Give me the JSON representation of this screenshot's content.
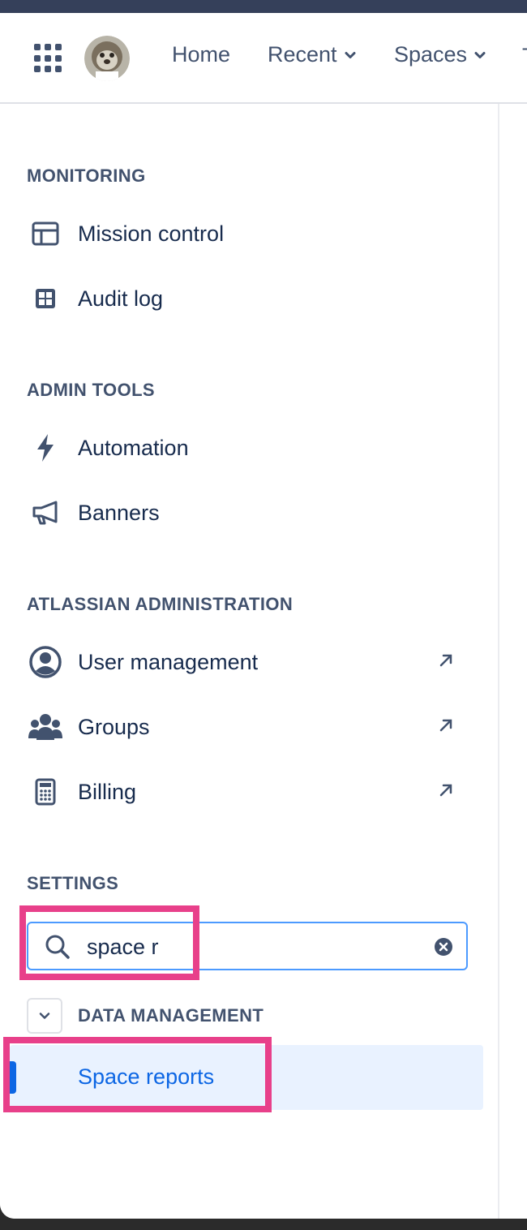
{
  "header": {
    "nav": [
      {
        "label": "Home",
        "has_chevron": false
      },
      {
        "label": "Recent",
        "has_chevron": true
      },
      {
        "label": "Spaces",
        "has_chevron": true
      }
    ],
    "overflow_char": "T"
  },
  "sidebar": {
    "sections": [
      {
        "title": "MONITORING",
        "items": [
          {
            "label": "Mission control",
            "icon": "layout-icon",
            "external": false
          },
          {
            "label": "Audit log",
            "icon": "grid-icon",
            "external": false
          }
        ]
      },
      {
        "title": "ADMIN TOOLS",
        "items": [
          {
            "label": "Automation",
            "icon": "lightning-icon",
            "external": false
          },
          {
            "label": "Banners",
            "icon": "megaphone-icon",
            "external": false
          }
        ]
      },
      {
        "title": "ATLASSIAN ADMINISTRATION",
        "items": [
          {
            "label": "User management",
            "icon": "user-circle-icon",
            "external": true
          },
          {
            "label": "Groups",
            "icon": "people-icon",
            "external": true
          },
          {
            "label": "Billing",
            "icon": "calculator-icon",
            "external": true
          }
        ]
      }
    ],
    "settings": {
      "title": "SETTINGS",
      "search_value": "space r",
      "group_title": "DATA MANAGEMENT",
      "active_item": "Space reports"
    }
  },
  "colors": {
    "accent": "#0c66e4",
    "highlight": "#e8408a",
    "focus_border": "#4c9aff",
    "text": "#172b4d",
    "muted": "#42526e"
  }
}
